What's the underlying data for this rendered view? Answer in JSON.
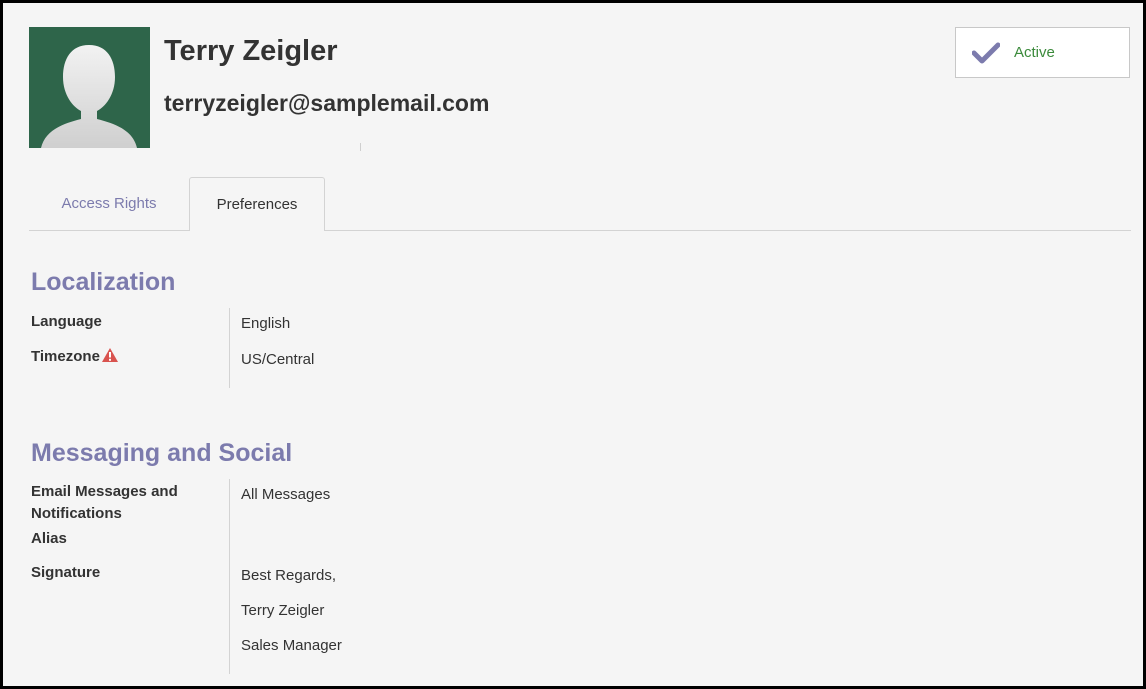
{
  "user": {
    "name": "Terry Zeigler",
    "email": "terryzeigler@samplemail.com"
  },
  "status": {
    "label": "Active",
    "icon": "check-icon",
    "color": "#3b8a3b"
  },
  "tabs": [
    {
      "label": "Access Rights",
      "active": false
    },
    {
      "label": "Preferences",
      "active": true
    }
  ],
  "localization": {
    "title": "Localization",
    "language_label": "Language",
    "language_value": "English",
    "timezone_label": "Timezone",
    "timezone_value": "US/Central",
    "timezone_icon": "warning-icon"
  },
  "messaging": {
    "title": "Messaging and Social",
    "email_label": "Email Messages and Notifications",
    "email_value": "All Messages",
    "alias_label": "Alias",
    "signature_label": "Signature",
    "signature_lines": [
      "Best Regards,",
      "Terry Zeigler",
      "Sales Manager"
    ]
  },
  "colors": {
    "accent": "#7c7bad",
    "avatar_bg": "#2e654a",
    "warning": "#d9534f"
  }
}
